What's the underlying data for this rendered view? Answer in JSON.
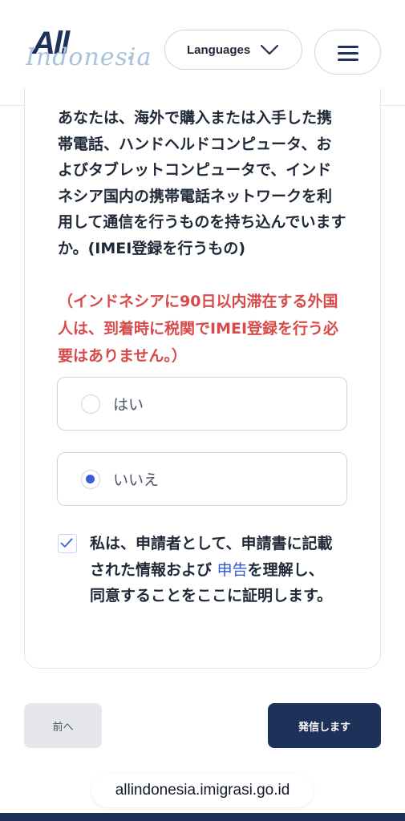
{
  "header": {
    "logo_main": "All",
    "logo_sub": "Indonesia",
    "language_label": "Languages",
    "menu_icon": "hamburger-icon",
    "chevron_icon": "chevron-down-icon"
  },
  "form": {
    "question": "あなたは、海外で購入または入手した携帯電話、ハンドヘルドコンピュータ、およびタブレットコンピュータで、インドネシア国内の携帯電話ネットワークを利用して通信を行うものを持ち込んでいますか。(IMEI登録を行うもの)",
    "note": "（インドネシアに90日以内滞在する外国人は、到着時に税関でIMEI登録を行う必要はありません。）",
    "options": [
      {
        "label": "はい",
        "selected": false
      },
      {
        "label": "いいえ",
        "selected": true
      }
    ],
    "consent_before": "私は、申請者として、申請書に記載された情報および ",
    "consent_link": "申告",
    "consent_after": "を理解し、同意することをここに証明します。",
    "consent_checked": true
  },
  "buttons": {
    "prev": "前へ",
    "submit": "発信します"
  },
  "browser": {
    "url": "allindonesia.imigrasi.go.id"
  },
  "colors": {
    "brand_navy": "#1e3158",
    "note_red": "#d84a4a",
    "link_blue": "#2f58c8",
    "radio_blue": "#3b5bdb"
  }
}
